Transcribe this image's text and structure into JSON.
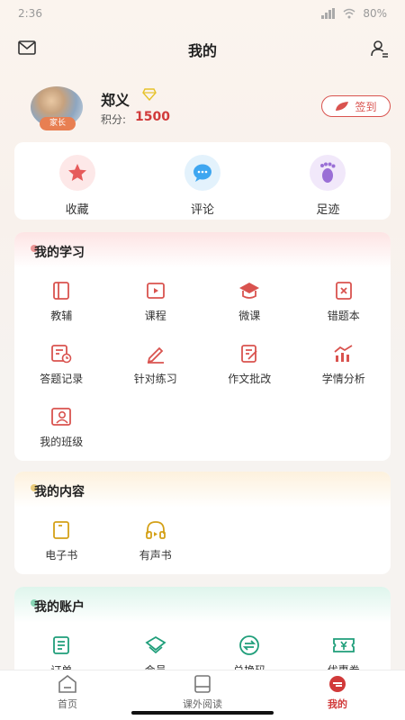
{
  "statusbar": {
    "time": "2:36",
    "battery": "80%"
  },
  "header": {
    "title": "我的"
  },
  "profile": {
    "name": "郑义",
    "role_badge": "家长",
    "points_label": "积分:",
    "points_value": "1500",
    "signin_label": "签到"
  },
  "quick_actions": [
    {
      "label": "收藏",
      "icon": "star-icon",
      "color": "#e65b5b"
    },
    {
      "label": "评论",
      "icon": "chat-icon",
      "color": "#3ea6f0"
    },
    {
      "label": "足迹",
      "icon": "footprint-icon",
      "color": "#9a6fd6"
    }
  ],
  "study": {
    "title": "我的学习",
    "items": [
      {
        "label": "教辅",
        "icon": "book-icon"
      },
      {
        "label": "课程",
        "icon": "video-icon"
      },
      {
        "label": "微课",
        "icon": "graduation-cap-icon"
      },
      {
        "label": "错题本",
        "icon": "wrong-book-icon"
      },
      {
        "label": "答题记录",
        "icon": "record-icon"
      },
      {
        "label": "针对练习",
        "icon": "pencil-icon"
      },
      {
        "label": "作文批改",
        "icon": "edit-doc-icon"
      },
      {
        "label": "学情分析",
        "icon": "chart-icon"
      },
      {
        "label": "我的班级",
        "icon": "class-icon"
      }
    ]
  },
  "content": {
    "title": "我的内容",
    "items": [
      {
        "label": "电子书",
        "icon": "ebook-icon"
      },
      {
        "label": "有声书",
        "icon": "headphones-icon"
      }
    ]
  },
  "account": {
    "title": "我的账户",
    "items": [
      {
        "label": "订单",
        "icon": "order-icon"
      },
      {
        "label": "会员",
        "icon": "vip-icon"
      },
      {
        "label": "兑换码",
        "icon": "exchange-icon"
      },
      {
        "label": "优惠券",
        "icon": "coupon-icon"
      }
    ]
  },
  "tabbar": [
    {
      "label": "首页",
      "icon": "home-icon"
    },
    {
      "label": "课外阅读",
      "icon": "reading-icon"
    },
    {
      "label": "我的",
      "icon": "profile-icon",
      "active": true
    }
  ],
  "colors": {
    "accent": "#d13a3a",
    "study_icon": "#d9534f",
    "content_icon": "#d4a017",
    "account_icon": "#1f9e7a"
  }
}
